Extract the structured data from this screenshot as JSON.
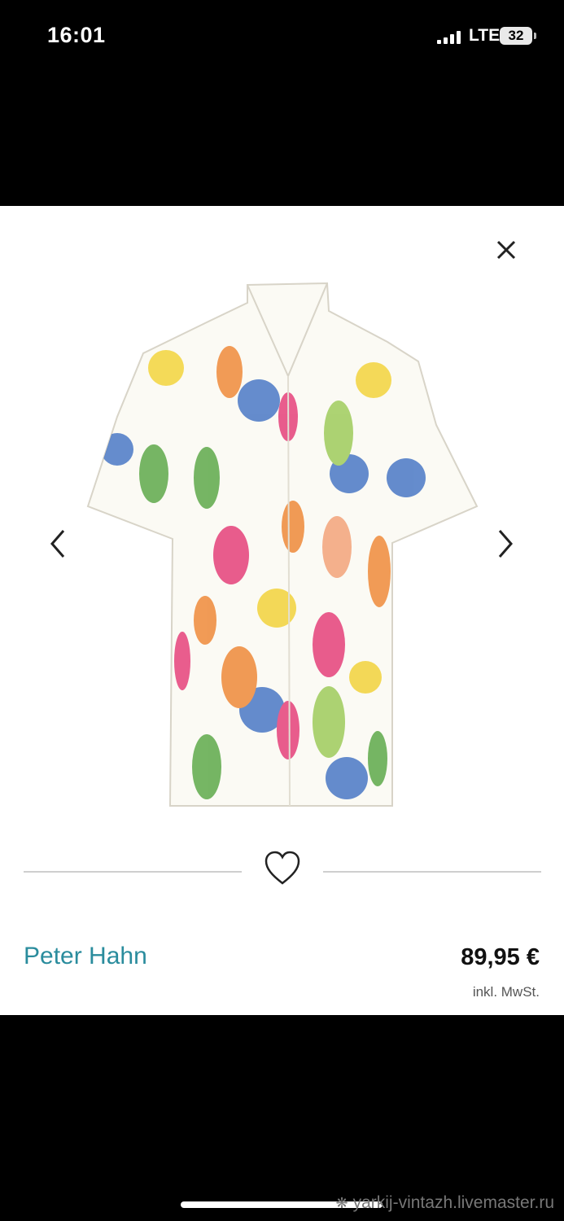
{
  "status_bar": {
    "time": "16:01",
    "network": "LTE",
    "battery": "32"
  },
  "product": {
    "brand": "Peter Hahn",
    "price": "89,95 €",
    "vat_note": "inkl. MwSt.",
    "image_icon": "shirt-image"
  },
  "controls": {
    "close_icon": "close-icon",
    "prev_icon": "chevron-left-icon",
    "next_icon": "chevron-right-icon",
    "favorite_icon": "heart-icon"
  },
  "watermark": {
    "text": "yarkij-vintazh.livemaster.ru"
  },
  "colors": {
    "brand": "#2a8c9d",
    "sheet_bg": "#ffffff",
    "screen_bg": "#000000"
  }
}
